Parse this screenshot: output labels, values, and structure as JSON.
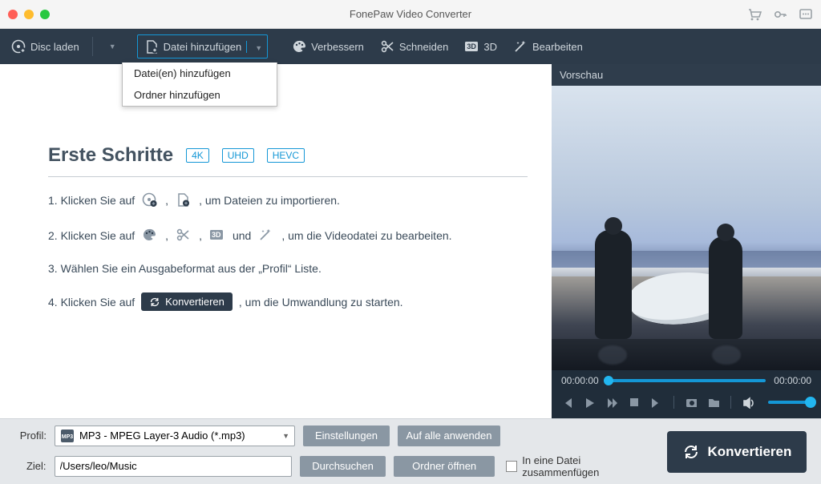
{
  "window": {
    "title": "FonePaw Video Converter"
  },
  "toolbar": {
    "disc": "Disc laden",
    "addfile": "Datei hinzufügen",
    "enhance": "Verbessern",
    "cut": "Schneiden",
    "td": "3D",
    "edit": "Bearbeiten"
  },
  "dropdown": {
    "addFiles": "Datei(en) hinzufügen",
    "addFolder": "Ordner hinzufügen"
  },
  "preview": {
    "title": "Vorschau",
    "timeStart": "00:00:00",
    "timeEnd": "00:00:00"
  },
  "gs": {
    "title": "Erste Schritte",
    "tag1": "4K",
    "tag2": "UHD",
    "tag3": "HEVC",
    "s1a": "1. Klicken Sie auf",
    "s1b": ",",
    "s1c": ", um Dateien zu importieren.",
    "s2a": "2. Klicken Sie auf",
    "s2comma": ",",
    "s2und": "und",
    "s2b": ", um die Videodatei zu bearbeiten.",
    "s3": "3. Wählen Sie ein Ausgabeformat aus der „Profil“ Liste.",
    "s4a": "4. Klicken Sie auf",
    "s4btn": "Konvertieren",
    "s4b": ", um die Umwandlung zu starten."
  },
  "bottom": {
    "profileLabel": "Profil:",
    "profileValue": "MP3 - MPEG Layer-3 Audio (*.mp3)",
    "destLabel": "Ziel:",
    "destValue": "/Users/leo/Music",
    "settings": "Einstellungen",
    "applyAll": "Auf alle anwenden",
    "browse": "Durchsuchen",
    "openFolder": "Ordner öffnen",
    "merge": "In eine Datei zusammenfügen",
    "convert": "Konvertieren"
  }
}
